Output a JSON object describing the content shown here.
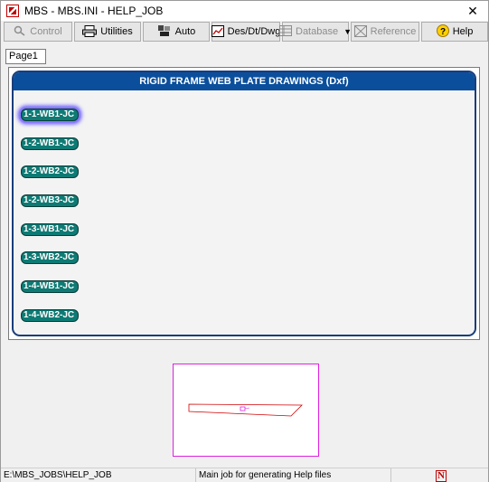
{
  "window": {
    "title": "MBS - MBS.INI - HELP_JOB",
    "close_symbol": "✕"
  },
  "toolbar": {
    "buttons": [
      {
        "label": "Control",
        "icon": "control-icon",
        "enabled": false
      },
      {
        "label": "Utilities",
        "icon": "printer-icon",
        "enabled": true
      },
      {
        "label": "Auto",
        "icon": "auto-icon",
        "enabled": true
      },
      {
        "label": "Des/Dt/Dwg",
        "icon": "chart-icon",
        "enabled": true
      },
      {
        "label": "Database",
        "icon": "database-icon",
        "enabled": false,
        "dropdown": true
      },
      {
        "label": "Reference",
        "icon": "reference-icon",
        "enabled": false
      },
      {
        "label": "Help",
        "icon": "help-icon",
        "enabled": true
      }
    ]
  },
  "tab": {
    "label": "Page1"
  },
  "panel": {
    "title": "RIGID FRAME WEB PLATE DRAWINGS (Dxf)",
    "drawings": [
      {
        "label": "1-1-WB1-JC",
        "selected": true
      },
      {
        "label": "1-2-WB1-JC",
        "selected": false
      },
      {
        "label": "1-2-WB2-JC",
        "selected": false
      },
      {
        "label": "1-2-WB3-JC",
        "selected": false
      },
      {
        "label": "1-3-WB1-JC",
        "selected": false
      },
      {
        "label": "1-3-WB2-JC",
        "selected": false
      },
      {
        "label": "1-4-WB1-JC",
        "selected": false
      },
      {
        "label": "1-4-WB2-JC",
        "selected": false
      }
    ]
  },
  "preview": {
    "frame_color": "#e020e0",
    "shape_color": "#d00000",
    "marker_color": "#e020e0"
  },
  "statusbar": {
    "path": "E:\\MBS_JOBS\\HELP_JOB",
    "description": "Main job for generating Help files",
    "logo": "N"
  },
  "colors": {
    "header_bg": "#0b4f9c",
    "drawing_button_bg": "#0e7a74",
    "selection_glow": "#5b4bff"
  }
}
